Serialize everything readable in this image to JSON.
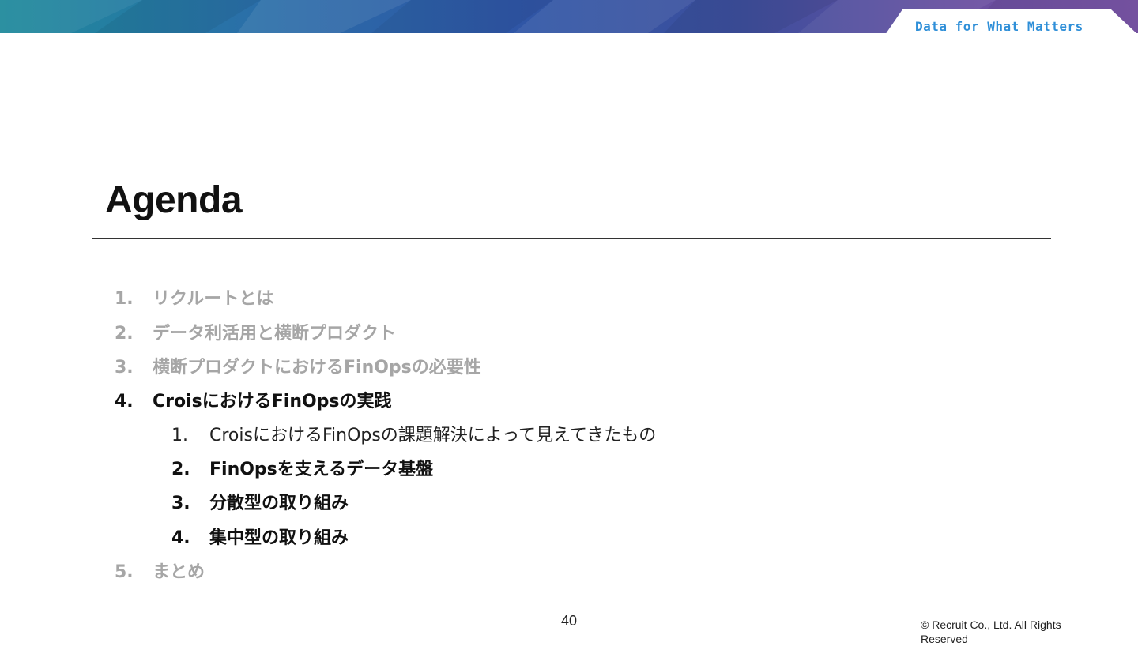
{
  "header": {
    "tagline": "Data for What Matters"
  },
  "slide": {
    "title": "Agenda",
    "page_number": "40",
    "copyright": "© Recruit Co., Ltd. All Rights Reserved"
  },
  "agenda": {
    "items": [
      {
        "num": "1.",
        "label": "リクルートとは",
        "state": "dimmed"
      },
      {
        "num": "2.",
        "label": "データ利活用と横断プロダクト",
        "state": "dimmed"
      },
      {
        "num": "3.",
        "label": "横断プロダクトにおけるFinOpsの必要性",
        "state": "dimmed"
      },
      {
        "num": "4.",
        "label": "CroisにおけるFinOpsの実践",
        "state": "current"
      },
      {
        "num": "5.",
        "label": "まとめ",
        "state": "dimmed"
      }
    ],
    "subitems": [
      {
        "num": "1.",
        "label": "CroisにおけるFinOpsの課題解決によって見えてきたもの",
        "state": "regular"
      },
      {
        "num": "2.",
        "label": "FinOpsを支えるデータ基盤",
        "state": "current"
      },
      {
        "num": "3.",
        "label": "分散型の取り組み",
        "state": "current"
      },
      {
        "num": "4.",
        "label": "集中型の取り組み",
        "state": "current"
      }
    ]
  },
  "colors": {
    "dimmed_text": "#a6a6a6",
    "current_text": "#111111",
    "tagline": "#2f8fd8"
  }
}
